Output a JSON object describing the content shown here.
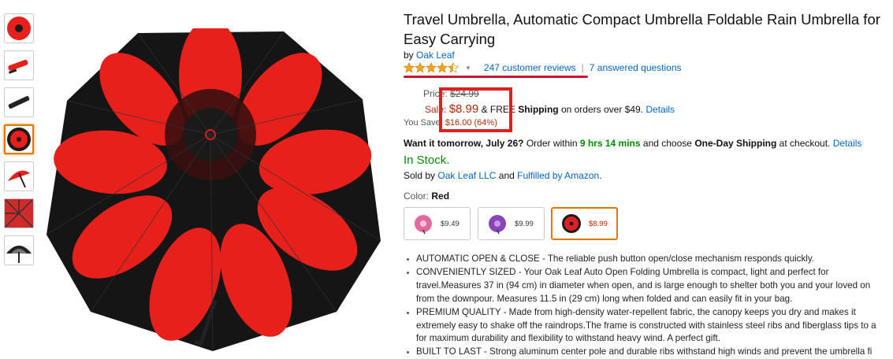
{
  "product": {
    "title_line1": "Travel Umbrella, Automatic Compact Umbrella Foldable Rain Umbrella for",
    "title_line2": "Easy Carrying",
    "by_prefix": "by",
    "brand": "Oak Leaf",
    "rating_stars": 4.5,
    "reviews_link": "247 customer reviews",
    "separator": "|",
    "questions_link": "7 answered questions"
  },
  "pricing": {
    "price_label": "Price:",
    "list_price": "$24.99",
    "sale_label": "Sale:",
    "sale_price": "$8.99",
    "shipping_prefix": "& FREE",
    "shipping_bold": "Shipping",
    "shipping_suffix": "on orders over $49.",
    "details_link": "Details",
    "save_label": "You Save:",
    "save_amount": "$16.00 (64%)"
  },
  "delivery": {
    "want_it": "Want it tomorrow, July 26?",
    "order_within": "Order within",
    "time": "9 hrs 14 mins",
    "choose": "and choose",
    "one_day": "One-Day Shipping",
    "checkout": "at checkout.",
    "details_link": "Details"
  },
  "availability": {
    "stock": "In Stock.",
    "sold_by_prefix": "Sold by",
    "seller": "Oak Leaf LLC",
    "and": "and",
    "fulfilled": "Fulfilled by Amazon",
    "period": "."
  },
  "color": {
    "label": "Color:",
    "value": "Red",
    "swatches": [
      {
        "price": "$9.49",
        "color": "#e06aa0",
        "selected": false
      },
      {
        "price": "$9.99",
        "color": "#8a44b8",
        "selected": false
      },
      {
        "price": "$8.99",
        "color": "#e02020",
        "selected": true
      }
    ]
  },
  "bullets": [
    "AUTOMATIC OPEN & CLOSE - The reliable push button open/close mechanism responds quickly.",
    "CONVENIENTLY SIZED - Your Oak Leaf Auto Open Folding Umbrella is compact, light and perfect for",
    "travel.Measures 37 in (94 cm) in diameter when open, and is large enough to shelter both you and your loved on",
    "from the downpour. Measures 11.5 in (29 cm) long when folded and can easily fit in your bag.",
    "PREMIUM QUALITY - Made from high-density water-repellent fabric, the canopy keeps you dry and makes it",
    "extremely easy to shake off the raindrops.The frame is constructed with stainless steel ribs and fiberglass tips to a",
    "for maximum durability and flexibility to withstand heavy wind. A perfect gift.",
    "BUILT TO LAST - Strong aluminum center pole and durable ribs withstand high winds and prevent the umbrella fi"
  ],
  "colors": {
    "link": "#0066c0",
    "price": "#b12704",
    "stock": "#008a00",
    "highlight": "#e02020",
    "selected": "#e77600"
  }
}
